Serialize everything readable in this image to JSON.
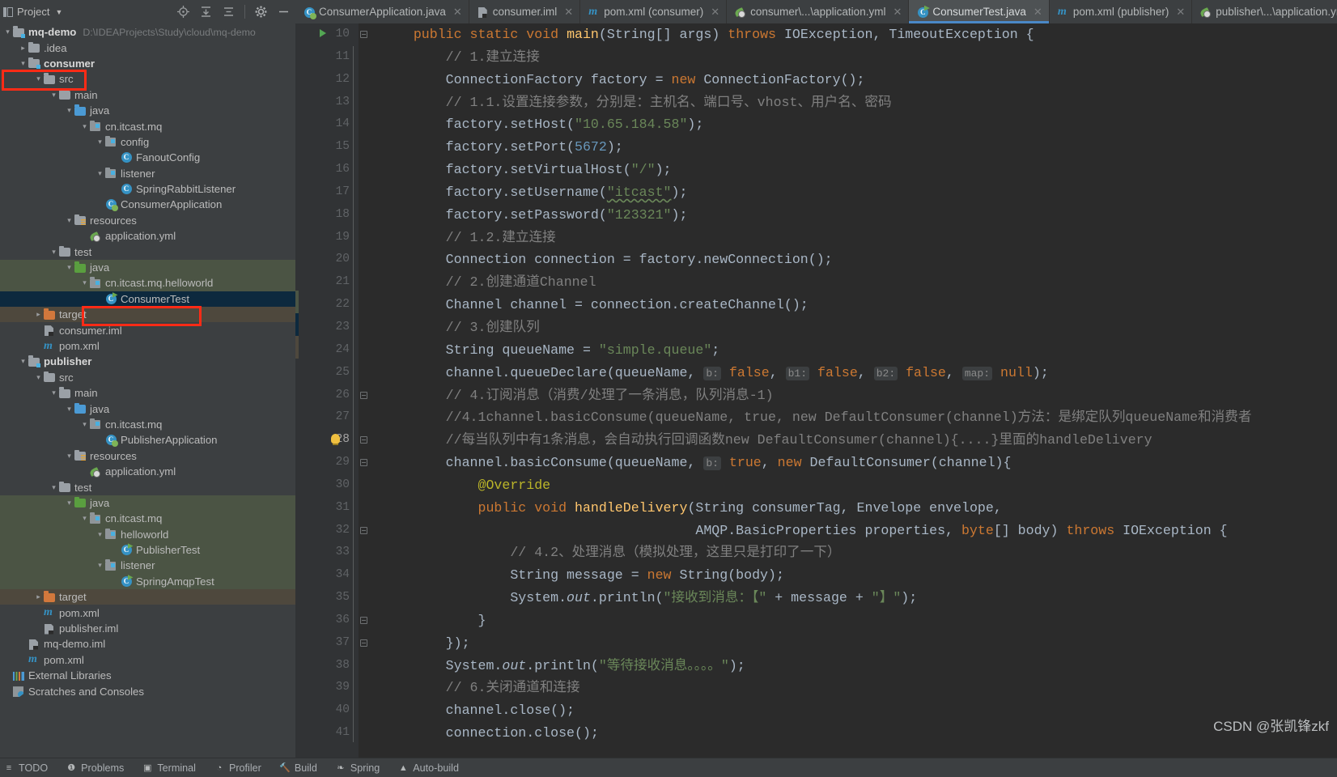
{
  "project_panel": {
    "title": "Project",
    "caret_icon": "chevron-down-icon",
    "toolbar_icons": [
      "locate-icon",
      "expand-all-icon",
      "collapse-all-icon",
      "settings-gear-icon",
      "hide-icon"
    ],
    "tree": [
      {
        "depth": 0,
        "arrow": "v",
        "icon": "module-folder",
        "label": "mq-demo",
        "path": "D:\\IDEAProjects\\Study\\cloud\\mq-demo",
        "bold": true,
        "state": "normal"
      },
      {
        "depth": 1,
        "arrow": ">",
        "icon": "folder",
        "label": ".idea",
        "path": "",
        "bold": false,
        "state": "normal"
      },
      {
        "depth": 1,
        "arrow": "v",
        "icon": "module-folder",
        "label": "consumer",
        "path": "",
        "bold": true,
        "state": "highlight"
      },
      {
        "depth": 2,
        "arrow": "v",
        "icon": "folder",
        "label": "src",
        "path": "",
        "bold": false,
        "state": "normal"
      },
      {
        "depth": 3,
        "arrow": "v",
        "icon": "folder",
        "label": "main",
        "path": "",
        "bold": false,
        "state": "normal"
      },
      {
        "depth": 4,
        "arrow": "v",
        "icon": "source-folder",
        "label": "java",
        "path": "",
        "bold": false,
        "state": "normal"
      },
      {
        "depth": 5,
        "arrow": "v",
        "icon": "package",
        "label": "cn.itcast.mq",
        "path": "",
        "bold": false,
        "state": "normal"
      },
      {
        "depth": 6,
        "arrow": "v",
        "icon": "package",
        "label": "config",
        "path": "",
        "bold": false,
        "state": "normal"
      },
      {
        "depth": 7,
        "arrow": "",
        "icon": "class",
        "label": "FanoutConfig",
        "path": "",
        "bold": false,
        "state": "normal"
      },
      {
        "depth": 6,
        "arrow": "v",
        "icon": "package",
        "label": "listener",
        "path": "",
        "bold": false,
        "state": "normal"
      },
      {
        "depth": 7,
        "arrow": "",
        "icon": "class",
        "label": "SpringRabbitListener",
        "path": "",
        "bold": false,
        "state": "normal"
      },
      {
        "depth": 6,
        "arrow": "",
        "icon": "class-spring",
        "label": "ConsumerApplication",
        "path": "",
        "bold": false,
        "state": "normal"
      },
      {
        "depth": 4,
        "arrow": "v",
        "icon": "resource-folder",
        "label": "resources",
        "path": "",
        "bold": false,
        "state": "normal"
      },
      {
        "depth": 5,
        "arrow": "",
        "icon": "yaml",
        "label": "application.yml",
        "path": "",
        "bold": false,
        "state": "normal"
      },
      {
        "depth": 3,
        "arrow": "v",
        "icon": "folder",
        "label": "test",
        "path": "",
        "bold": false,
        "state": "normal"
      },
      {
        "depth": 4,
        "arrow": "v",
        "icon": "test-folder",
        "label": "java",
        "path": "",
        "bold": false,
        "state": "tests"
      },
      {
        "depth": 5,
        "arrow": "v",
        "icon": "package",
        "label": "cn.itcast.mq.helloworld",
        "path": "",
        "bold": false,
        "state": "tests"
      },
      {
        "depth": 6,
        "arrow": "",
        "icon": "class-run",
        "label": "ConsumerTest",
        "path": "",
        "bold": false,
        "state": "selected"
      },
      {
        "depth": 2,
        "arrow": ">",
        "icon": "target-folder",
        "label": "target",
        "path": "",
        "bold": false,
        "state": "target"
      },
      {
        "depth": 2,
        "arrow": "",
        "icon": "iml",
        "label": "consumer.iml",
        "path": "",
        "bold": false,
        "state": "normal"
      },
      {
        "depth": 2,
        "arrow": "",
        "icon": "maven",
        "label": "pom.xml",
        "path": "",
        "bold": false,
        "state": "normal"
      },
      {
        "depth": 1,
        "arrow": "v",
        "icon": "module-folder",
        "label": "publisher",
        "path": "",
        "bold": true,
        "state": "normal"
      },
      {
        "depth": 2,
        "arrow": "v",
        "icon": "folder",
        "label": "src",
        "path": "",
        "bold": false,
        "state": "normal"
      },
      {
        "depth": 3,
        "arrow": "v",
        "icon": "folder",
        "label": "main",
        "path": "",
        "bold": false,
        "state": "normal"
      },
      {
        "depth": 4,
        "arrow": "v",
        "icon": "source-folder",
        "label": "java",
        "path": "",
        "bold": false,
        "state": "normal"
      },
      {
        "depth": 5,
        "arrow": "v",
        "icon": "package",
        "label": "cn.itcast.mq",
        "path": "",
        "bold": false,
        "state": "normal"
      },
      {
        "depth": 6,
        "arrow": "",
        "icon": "class-spring",
        "label": "PublisherApplication",
        "path": "",
        "bold": false,
        "state": "normal"
      },
      {
        "depth": 4,
        "arrow": "v",
        "icon": "resource-folder",
        "label": "resources",
        "path": "",
        "bold": false,
        "state": "normal"
      },
      {
        "depth": 5,
        "arrow": "",
        "icon": "yaml",
        "label": "application.yml",
        "path": "",
        "bold": false,
        "state": "normal"
      },
      {
        "depth": 3,
        "arrow": "v",
        "icon": "folder",
        "label": "test",
        "path": "",
        "bold": false,
        "state": "normal"
      },
      {
        "depth": 4,
        "arrow": "v",
        "icon": "test-folder",
        "label": "java",
        "path": "",
        "bold": false,
        "state": "tests"
      },
      {
        "depth": 5,
        "arrow": "v",
        "icon": "package",
        "label": "cn.itcast.mq",
        "path": "",
        "bold": false,
        "state": "tests"
      },
      {
        "depth": 6,
        "arrow": "v",
        "icon": "package",
        "label": "helloworld",
        "path": "",
        "bold": false,
        "state": "tests"
      },
      {
        "depth": 7,
        "arrow": "",
        "icon": "class-run",
        "label": "PublisherTest",
        "path": "",
        "bold": false,
        "state": "tests"
      },
      {
        "depth": 6,
        "arrow": "v",
        "icon": "package",
        "label": "listener",
        "path": "",
        "bold": false,
        "state": "tests"
      },
      {
        "depth": 7,
        "arrow": "",
        "icon": "class-run",
        "label": "SpringAmqpTest",
        "path": "",
        "bold": false,
        "state": "tests"
      },
      {
        "depth": 2,
        "arrow": ">",
        "icon": "target-folder",
        "label": "target",
        "path": "",
        "bold": false,
        "state": "target"
      },
      {
        "depth": 2,
        "arrow": "",
        "icon": "maven",
        "label": "pom.xml",
        "path": "",
        "bold": false,
        "state": "normal"
      },
      {
        "depth": 2,
        "arrow": "",
        "icon": "iml",
        "label": "publisher.iml",
        "path": "",
        "bold": false,
        "state": "normal"
      },
      {
        "depth": 1,
        "arrow": "",
        "icon": "iml",
        "label": "mq-demo.iml",
        "path": "",
        "bold": false,
        "state": "normal"
      },
      {
        "depth": 1,
        "arrow": "",
        "icon": "maven",
        "label": "pom.xml",
        "path": "",
        "bold": false,
        "state": "normal"
      },
      {
        "depth": 0,
        "arrow": "",
        "icon": "external-libraries",
        "label": "External Libraries",
        "path": "",
        "bold": false,
        "state": "normal"
      },
      {
        "depth": 0,
        "arrow": "",
        "icon": "scratches",
        "label": "Scratches and Consoles",
        "path": "",
        "bold": false,
        "state": "normal"
      }
    ]
  },
  "editor_tabs": [
    {
      "label": "ConsumerApplication.java",
      "icon": "class-spring",
      "active": false
    },
    {
      "label": "consumer.iml",
      "icon": "iml",
      "active": false
    },
    {
      "label": "pom.xml (consumer)",
      "icon": "maven",
      "active": false
    },
    {
      "label": "consumer\\...\\application.yml",
      "icon": "yaml",
      "active": false
    },
    {
      "label": "ConsumerTest.java",
      "icon": "class-run",
      "active": true
    },
    {
      "label": "pom.xml (publisher)",
      "icon": "maven",
      "active": false
    },
    {
      "label": "publisher\\...\\application.yml",
      "icon": "yaml",
      "active": false
    }
  ],
  "editor": {
    "first_line": 10,
    "current_line": 28,
    "run_marker_line": 10,
    "bulb_line": 28,
    "lines": [
      {
        "n": 10,
        "html": "    <span class=\"kw\">public static void</span> <span class=\"fn\">main</span>(String[] args) <span class=\"kw\">throws</span> IOException, TimeoutException {"
      },
      {
        "n": 11,
        "html": "        <span class=\"cm\">// 1.建立连接</span>"
      },
      {
        "n": 12,
        "html": "        ConnectionFactory factory = <span class=\"kw\">new</span> ConnectionFactory();"
      },
      {
        "n": 13,
        "html": "        <span class=\"cm\">// 1.1.设置连接参数，分别是：主机名、端口号、vhost、用户名、密码</span>"
      },
      {
        "n": 14,
        "html": "        factory.setHost(<span class=\"st\">\"10.65.184.58\"</span>);"
      },
      {
        "n": 15,
        "html": "        factory.setPort(<span class=\"nu\">5672</span>);"
      },
      {
        "n": 16,
        "html": "        factory.setVirtualHost(<span class=\"st\">\"/\"</span>);"
      },
      {
        "n": 17,
        "html": "        factory.setUsername(<span class=\"st sq\">\"itcast\"</span>);"
      },
      {
        "n": 18,
        "html": "        factory.setPassword(<span class=\"st\">\"123321\"</span>);"
      },
      {
        "n": 19,
        "html": "        <span class=\"cm\">// 1.2.建立连接</span>"
      },
      {
        "n": 20,
        "html": "        Connection connection = factory.newConnection();"
      },
      {
        "n": 21,
        "html": "        <span class=\"cm\">// 2.创建通道Channel</span>"
      },
      {
        "n": 22,
        "html": "        Channel channel = connection.createChannel();"
      },
      {
        "n": 23,
        "html": "        <span class=\"cm\">// 3.创建队列</span>"
      },
      {
        "n": 24,
        "html": "        String queueName = <span class=\"st\">\"simple.queue\"</span>;"
      },
      {
        "n": 25,
        "html": "        channel.queueDeclare(queueName, <span class=\"hint\">b:</span> <span class=\"kw\">false</span>, <span class=\"hint\">b1:</span> <span class=\"kw\">false</span>, <span class=\"hint\">b2:</span> <span class=\"kw\">false</span>, <span class=\"hint\">map:</span> <span class=\"kw\">null</span>);"
      },
      {
        "n": 26,
        "html": "        <span class=\"cm\">// 4.订阅消息（消费/处理了一条消息，队列消息-1)</span>"
      },
      {
        "n": 27,
        "html": "        <span class=\"cm\">//4.1channel.basicConsume(queueName, true, new DefaultConsumer(channel)方法：是绑定队列queueName和消费者</span>"
      },
      {
        "n": 28,
        "html": "        <span class=\"cm\">//每当队列中有1条消息，会自动执行回调函数new DefaultConsumer(channel){....}里面的handleDelivery</span>"
      },
      {
        "n": 29,
        "html": "        channel.basicConsume(queueName, <span class=\"hint\">b:</span> <span class=\"kw\">true</span>, <span class=\"kw\">new</span> DefaultConsumer(channel){"
      },
      {
        "n": 30,
        "html": "            <span class=\"an\">@Override</span>"
      },
      {
        "n": 31,
        "html": "            <span class=\"kw\">public void</span> <span class=\"fn\">handleDelivery</span>(String consumerTag, Envelope envelope,"
      },
      {
        "n": 32,
        "html": "                                       AMQP.BasicProperties properties, <span class=\"kw\">byte</span>[] body) <span class=\"kw\">throws</span> IOException {"
      },
      {
        "n": 33,
        "html": "                <span class=\"cm\">// 4.2、处理消息（模拟处理，这里只是打印了一下）</span>"
      },
      {
        "n": 34,
        "html": "                String message = <span class=\"kw\">new</span> String(body);"
      },
      {
        "n": 35,
        "html": "                System.<span class=\"it\">out</span>.println(<span class=\"st\">\"接收到消息：【\"</span> + message + <span class=\"st\">\"】\"</span>);"
      },
      {
        "n": 36,
        "html": "            }"
      },
      {
        "n": 37,
        "html": "        });"
      },
      {
        "n": 38,
        "html": "        System.<span class=\"it\">out</span>.println(<span class=\"st\">\"等待接收消息。。。。\"</span>);"
      },
      {
        "n": 39,
        "html": "        <span class=\"cm\">// 6.关闭通道和连接</span>"
      },
      {
        "n": 40,
        "html": "        channel.close();"
      },
      {
        "n": 41,
        "html": "        connection.close();"
      }
    ]
  },
  "status_bar": [
    {
      "label": "TODO",
      "icon": "todo-icon"
    },
    {
      "label": "Problems",
      "icon": "problems-icon"
    },
    {
      "label": "Terminal",
      "icon": "terminal-icon"
    },
    {
      "label": "Profiler",
      "icon": "profiler-icon"
    },
    {
      "label": "Build",
      "icon": "build-hammer-icon"
    },
    {
      "label": "Spring",
      "icon": "spring-leaf-icon"
    },
    {
      "label": "Auto-build",
      "icon": "auto-build-icon"
    }
  ],
  "watermark": "CSDN @张凯锋zkf",
  "colors": {
    "accent_blue": "#4a88c7",
    "highlight_red": "#fe2b16",
    "tests_green": "#4b5444",
    "target_brown": "#4e483d",
    "selection_navy": "#0d293e"
  }
}
